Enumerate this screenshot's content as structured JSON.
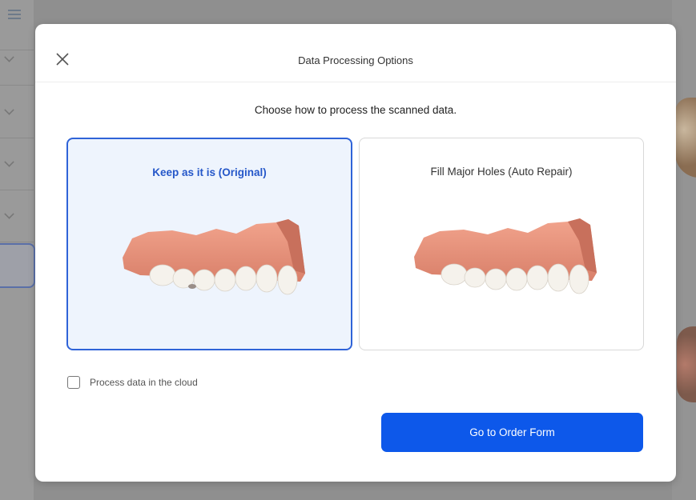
{
  "dialog": {
    "title": "Data Processing Options",
    "subtitle": "Choose how to process the scanned data."
  },
  "options": [
    {
      "label": "Keep as it is (Original)",
      "selected": true
    },
    {
      "label": "Fill Major Holes (Auto Repair)",
      "selected": false
    }
  ],
  "cloud_checkbox": {
    "label": "Process data in the cloud",
    "checked": false
  },
  "primary_button": {
    "label": "Go to Order Form"
  },
  "colors": {
    "accent": "#0d58ea",
    "selected_border": "#2f63d8",
    "selected_bg": "#eef4fd",
    "gum": "#e8957f",
    "teeth": "#f4f1ea"
  },
  "icons": {
    "close": "close-icon",
    "menu": "menu-icon",
    "chevron": "chevron-down-icon",
    "checkbox": "checkbox-icon"
  }
}
